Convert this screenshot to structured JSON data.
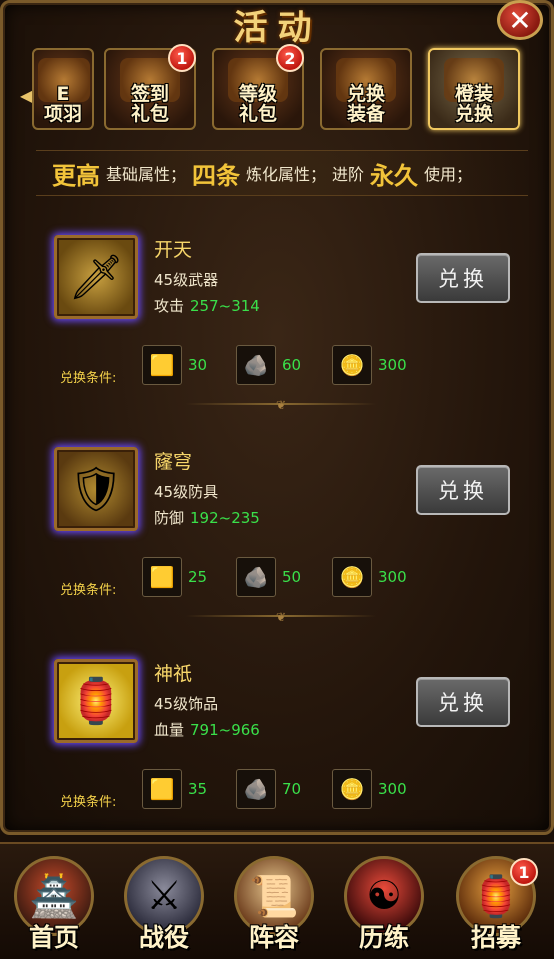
{
  "header": {
    "title": "活动",
    "close_icon": "close-icon"
  },
  "tabs": [
    {
      "label": "E\n项羽",
      "active": false
    },
    {
      "label": "签到\n礼包",
      "badge": "1",
      "active": false
    },
    {
      "label": "等级\n礼包",
      "badge": "2",
      "active": false
    },
    {
      "label": "兑换\n装备",
      "active": false
    },
    {
      "label": "橙装\n兑换",
      "active": true
    }
  ],
  "banner": {
    "p1": "更高",
    "p2": "基础属性；",
    "p3": "四条",
    "p4": "炼化属性；",
    "p5": "进阶",
    "p6": "永久",
    "p7": "使用；"
  },
  "items": [
    {
      "name": "开天",
      "type": "45级武器",
      "stat_label": "攻击",
      "stat_value": "257~314",
      "button": "兑换",
      "cond_label": "兑换条件:",
      "mats": [
        "30",
        "60",
        "300"
      ],
      "icon": "sword-icon"
    },
    {
      "name": "窿穹",
      "type": "45级防具",
      "stat_label": "防御",
      "stat_value": "192~235",
      "button": "兑换",
      "cond_label": "兑换条件:",
      "mats": [
        "25",
        "50",
        "300"
      ],
      "icon": "armor-icon"
    },
    {
      "name": "神祇",
      "type": "45级饰品",
      "stat_label": "血量",
      "stat_value": "791~966",
      "button": "兑换",
      "cond_label": "兑换条件:",
      "mats": [
        "35",
        "70",
        "300"
      ],
      "icon": "accessory-icon"
    }
  ],
  "nav": [
    {
      "label": "首页",
      "icon": "palace-icon"
    },
    {
      "label": "战役",
      "icon": "crossed-swords-icon"
    },
    {
      "label": "阵容",
      "icon": "scroll-icon"
    },
    {
      "label": "历练",
      "icon": "yin-yang-icon"
    },
    {
      "label": "招募",
      "icon": "recruit-icon",
      "badge": "1"
    }
  ],
  "colors": {
    "accent": "#f2c43a",
    "stat_value": "#3ae04a",
    "badge": "#c01810"
  }
}
